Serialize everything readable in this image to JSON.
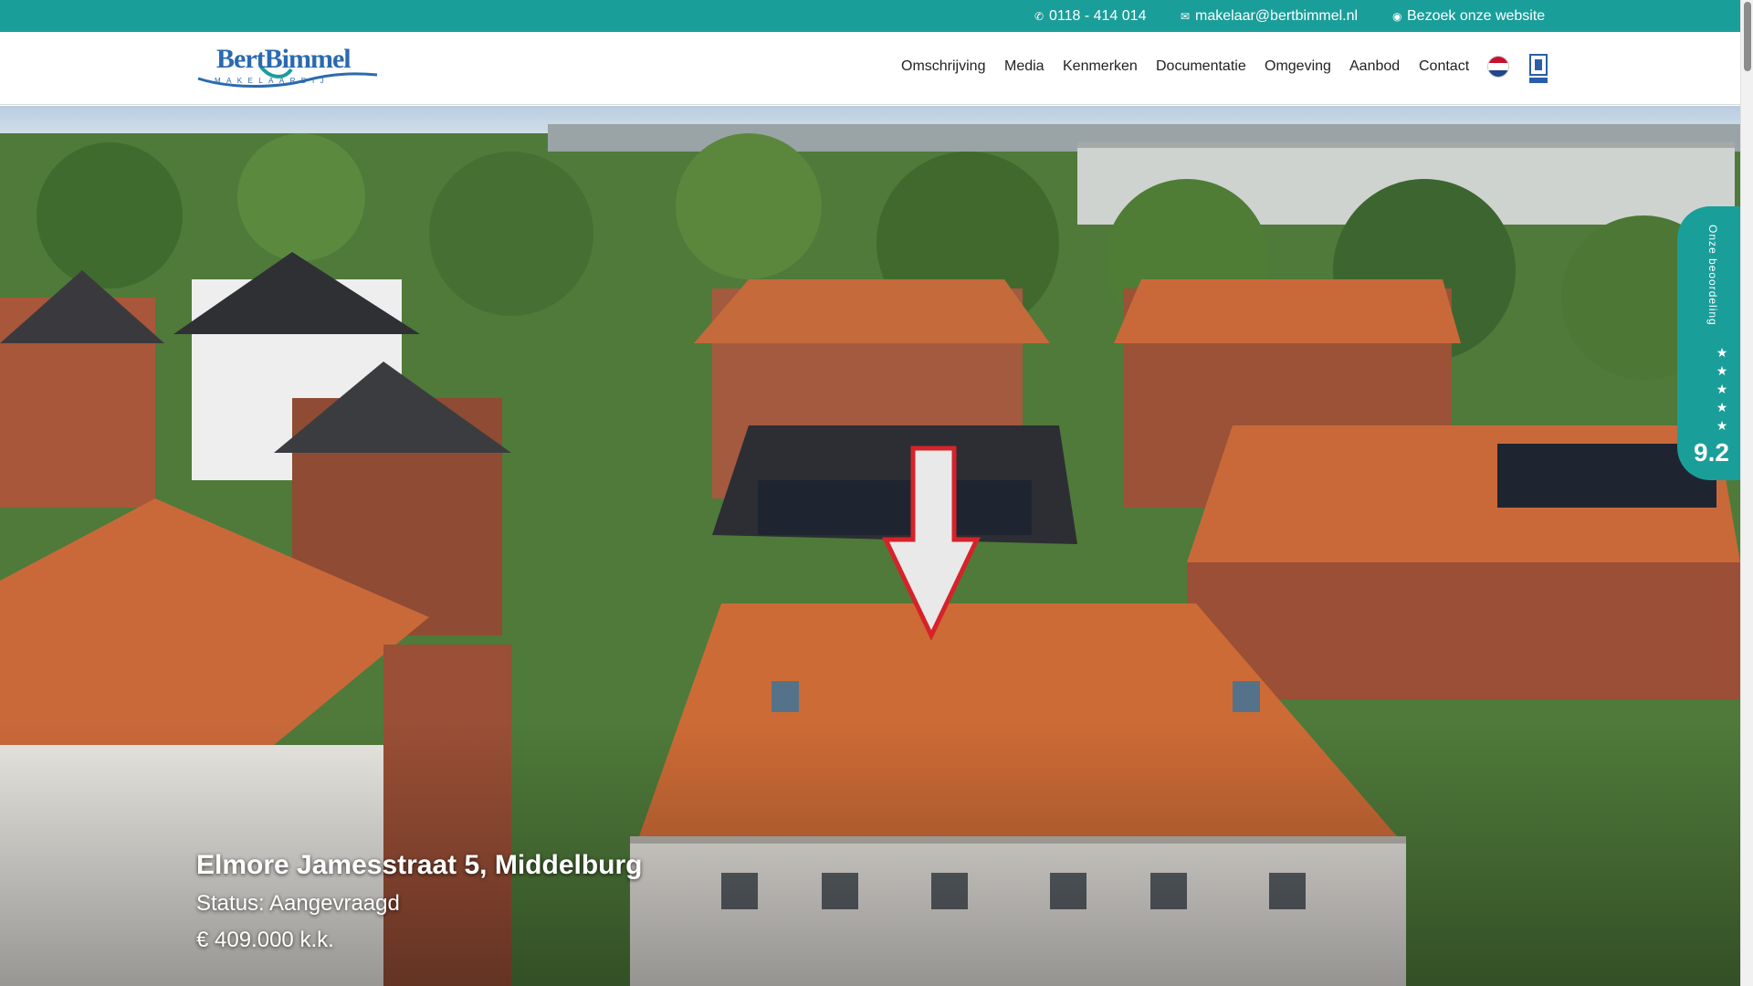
{
  "topbar": {
    "phone_icon": "phone-icon",
    "phone": "0118 - 414 014",
    "email_icon": "envelope-icon",
    "email": "makelaar@bertbimmel.nl",
    "website_icon": "globe-icon",
    "website": "Bezoek onze website",
    "background_color": "#1a9e9a"
  },
  "logo": {
    "name": "Bert Bimmel",
    "sub": "MAKELAARDIJ"
  },
  "nav": {
    "items": [
      "Omschrijving",
      "Media",
      "Kenmerken",
      "Documentatie",
      "Omgeving",
      "Aanbod",
      "Contact"
    ],
    "language_icon": "dutch-flag-icon",
    "nvm_icon": "nvm-logo-icon"
  },
  "hero": {
    "title": "Elmore Jamesstraat 5, Middelburg",
    "status": "Status: Aangevraagd",
    "price": "€ 409.000 k.k.",
    "image": "aerial-photo-of-houses-with-arrow"
  },
  "review": {
    "label": "Onze beoordeling",
    "stars": 5,
    "score": "9.2"
  }
}
